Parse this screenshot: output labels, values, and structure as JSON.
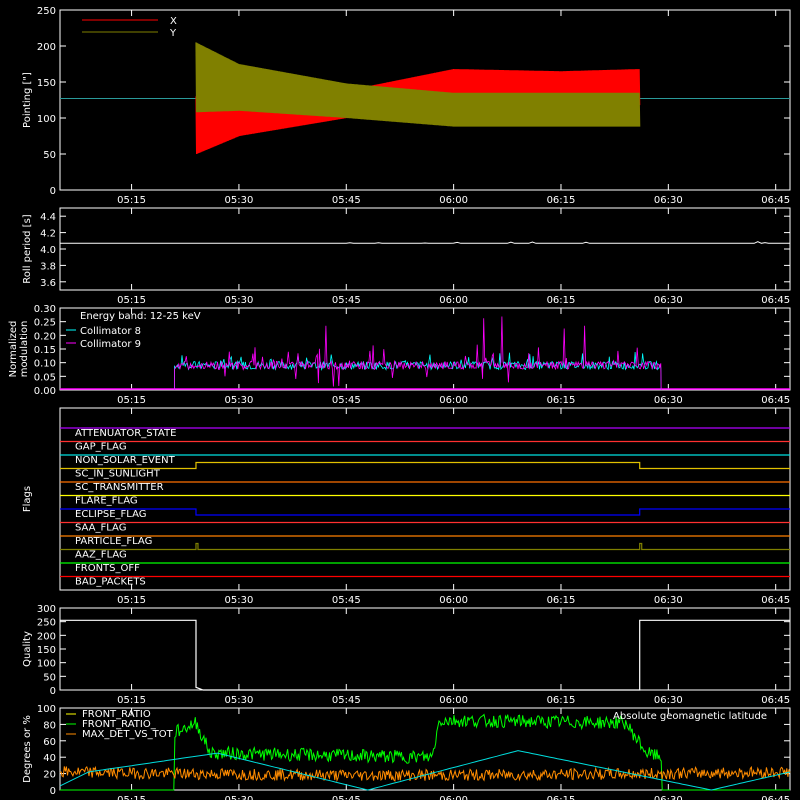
{
  "chart_data": [
    {
      "type": "line",
      "ylabel": "Pointing [\"]",
      "ylim": [
        0,
        250
      ],
      "yticks": [
        0,
        50,
        100,
        150,
        200,
        250
      ],
      "xlim": [
        "05:05",
        "06:47"
      ],
      "xticks": [
        "05:15",
        "05:30",
        "05:45",
        "06:00",
        "06:15",
        "06:30",
        "06:45"
      ],
      "reference_line": 127,
      "legend": [
        {
          "name": "X",
          "color": "#ff0000"
        },
        {
          "name": "Y",
          "color": "#808000"
        }
      ],
      "series": [
        {
          "name": "X",
          "color": "#ff0000",
          "x": [
            "05:24",
            "05:30",
            "05:45",
            "06:00",
            "06:15",
            "06:26"
          ],
          "low": [
            50,
            75,
            100,
            118,
            115,
            118
          ],
          "high": [
            130,
            128,
            138,
            168,
            165,
            168
          ]
        },
        {
          "name": "Y",
          "color": "#808000",
          "x": [
            "05:24",
            "05:30",
            "05:45",
            "06:00",
            "06:15",
            "06:26"
          ],
          "low": [
            108,
            110,
            100,
            88,
            88,
            88
          ],
          "high": [
            205,
            175,
            148,
            135,
            135,
            135
          ]
        }
      ]
    },
    {
      "type": "line",
      "ylabel": "Roll period [s]",
      "ylim": [
        3.5,
        4.5
      ],
      "yticks": [
        "3.6",
        "3.8",
        "4.0",
        "4.2",
        "4.4"
      ],
      "xticks": [
        "05:15",
        "05:30",
        "05:45",
        "06:00",
        "06:15",
        "06:30",
        "06:45"
      ],
      "series": [
        {
          "color": "#ffffff",
          "x": [
            "05:05",
            "06:47"
          ],
          "y": [
            4.07,
            4.07
          ]
        }
      ]
    },
    {
      "type": "line",
      "ylabel": "Normalized modulation",
      "ylim": [
        0,
        0.3
      ],
      "yticks": [
        "0.00",
        "0.05",
        "0.10",
        "0.15",
        "0.20",
        "0.25",
        "0.30"
      ],
      "xticks": [
        "05:15",
        "05:30",
        "05:45",
        "06:00",
        "06:15",
        "06:30",
        "06:45"
      ],
      "annotation": "Energy band: 12-25 keV",
      "series": [
        {
          "name": "Collimator 8",
          "color": "#00ffff",
          "x": [
            "05:21",
            "06:29"
          ],
          "baseline": 0.09,
          "spread": 0.05
        },
        {
          "name": "Collimator 9",
          "color": "#ff00ff",
          "x": [
            "05:21",
            "06:29"
          ],
          "baseline": 0.09,
          "spread": 0.08
        }
      ]
    },
    {
      "type": "line",
      "ylabel": "Flags",
      "xticks": [
        "05:15",
        "05:30",
        "05:45",
        "06:00",
        "06:15",
        "06:30",
        "06:45"
      ],
      "flags": [
        {
          "name": "ATTENUATOR_STATE",
          "color": "#b000ff",
          "steps": []
        },
        {
          "name": "GAP_FLAG",
          "color": "#ff3030",
          "steps": []
        },
        {
          "name": "NON_SOLAR_EVENT",
          "color": "#00e0e0",
          "steps": []
        },
        {
          "name": "SC_IN_SUNLIGHT",
          "color": "#e0c000",
          "steps": [
            [
              "05:24",
              "06:26"
            ]
          ]
        },
        {
          "name": "SC_TRANSMITTER",
          "color": "#ff7000",
          "steps": []
        },
        {
          "name": "FLARE_FLAG",
          "color": "#ffff00",
          "steps": []
        },
        {
          "name": "ECLIPSE_FLAG",
          "color": "#0000ff",
          "steps": [
            [
              "05:24",
              "06:26"
            ]
          ]
        },
        {
          "name": "SAA_FLAG",
          "color": "#ff3030",
          "steps": []
        },
        {
          "name": "PARTICLE_FLAG",
          "color": "#ff8000",
          "steps": []
        },
        {
          "name": "AAZ_FLAG",
          "color": "#808000",
          "spikes": [
            "05:24",
            "06:26"
          ]
        },
        {
          "name": "FRONTS_OFF",
          "color": "#00ff00",
          "steps": []
        },
        {
          "name": "BAD_PACKETS",
          "color": "#ff0000",
          "steps": []
        }
      ]
    },
    {
      "type": "line",
      "ylabel": "Quality",
      "ylim": [
        0,
        300
      ],
      "yticks": [
        0,
        50,
        100,
        150,
        200,
        250,
        300
      ],
      "xticks": [
        "05:15",
        "05:30",
        "05:45",
        "06:00",
        "06:15",
        "06:30",
        "06:45"
      ],
      "series": [
        {
          "color": "#ffffff",
          "x": [
            "05:05",
            "05:24",
            "05:24",
            "05:25",
            "06:26",
            "06:26",
            "06:47"
          ],
          "y": [
            255,
            255,
            10,
            0,
            0,
            255,
            255
          ]
        }
      ]
    },
    {
      "type": "line",
      "ylabel": "Degrees or %",
      "ylim": [
        0,
        100
      ],
      "yticks": [
        0,
        20,
        40,
        60,
        80,
        100
      ],
      "xticks": [
        "05:15",
        "05:30",
        "05:45",
        "06:00",
        "06:15",
        "06:30",
        "06:45"
      ],
      "annotation": "Absolute geomagnetic latitude",
      "legend": [
        {
          "name": "FRONT_RATIO",
          "color": "#ffff00"
        },
        {
          "name": "FRONT_RATIO_",
          "color": "#00ff00"
        },
        {
          "name": "MAX_DET_VS_TOT",
          "color": "#ff8c00"
        }
      ],
      "series": [
        {
          "name": "FRONT_RATIO_",
          "color": "#00ff00",
          "x": [
            "05:05",
            "05:21",
            "05:21",
            "05:24",
            "05:26",
            "05:57",
            "05:58",
            "06:24",
            "06:27",
            "06:29",
            "06:29",
            "06:47"
          ],
          "y": [
            0,
            0,
            70,
            82,
            45,
            40,
            85,
            82,
            45,
            40,
            0,
            0
          ]
        },
        {
          "name": "MAX_DET_VS_TOT",
          "color": "#ff8c00",
          "x": [
            "05:05",
            "05:21",
            "05:45",
            "06:00",
            "06:29",
            "06:47"
          ],
          "y": [
            22,
            20,
            18,
            18,
            20,
            22
          ]
        },
        {
          "name": "Absolute geomagnetic latitude",
          "color": "#00dddd",
          "x": [
            "05:05",
            "05:09",
            "05:27",
            "05:48",
            "06:09",
            "06:36",
            "06:47"
          ],
          "y": [
            5,
            22,
            45,
            0,
            48,
            0,
            22
          ]
        }
      ]
    }
  ]
}
